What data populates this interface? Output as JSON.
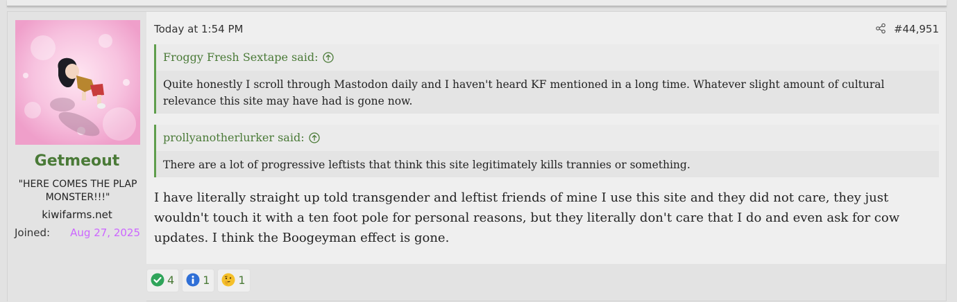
{
  "post": {
    "date": "Today at 1:54 PM",
    "number": "#44,951",
    "user": {
      "name": "Getmeout",
      "title": "\"HERE COMES THE PLAP MONSTER!!!\"",
      "site": "kiwifarms.net",
      "joined_label": "Joined:",
      "joined_value": "Aug 27, 2025"
    },
    "quotes": [
      {
        "attribution": "Froggy Fresh Sextape said:",
        "text": "Quite honestly I scroll through Mastodon daily and I haven't heard KF mentioned in a long time. Whatever slight amount of cultural relevance this site may have had is gone now."
      },
      {
        "attribution": "prollyanotherlurker said:",
        "text": "There are a lot of progressive leftists that think this site legitimately kills trannies or something."
      }
    ],
    "message": "I have literally straight up told transgender and leftist friends of mine I use this site and they did not care, they just wouldn't touch it with a ten foot pole for personal reasons, but they literally don't care that I do and even ask for cow updates. I think the Boogeyman effect is gone.",
    "reactions": [
      {
        "icon": "check-circle-icon",
        "count": "4",
        "color": "#2fa45a"
      },
      {
        "icon": "info-icon",
        "count": "1",
        "color": "#2f6fd6"
      },
      {
        "icon": "thinking-face-icon",
        "count": "1",
        "color": "#f5c02a"
      }
    ]
  },
  "colors": {
    "accent_green": "#4a7a37",
    "quote_border": "#5f9e4c",
    "joined_date": "#cc66ff"
  }
}
